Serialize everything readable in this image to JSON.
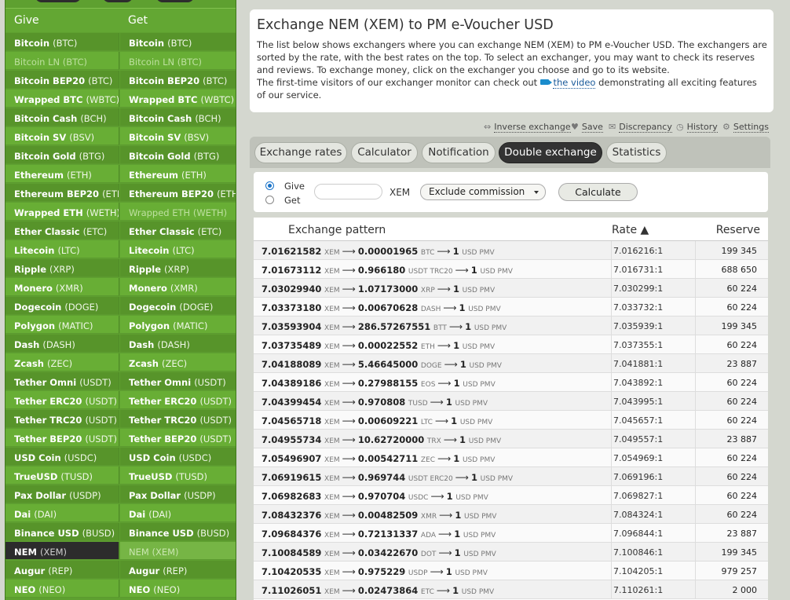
{
  "sidebar": {
    "give_label": "Give",
    "get_label": "Get",
    "rows": [
      {
        "name": "Bitcoin",
        "ticker": "(BTC)"
      },
      {
        "name": "Bitcoin LN",
        "ticker": "(BTC)"
      },
      {
        "name": "Bitcoin BEP20",
        "ticker": "(BTC)"
      },
      {
        "name": "Wrapped BTC",
        "ticker": "(WBTC)"
      },
      {
        "name": "Bitcoin Cash",
        "ticker": "(BCH)"
      },
      {
        "name": "Bitcoin SV",
        "ticker": "(BSV)"
      },
      {
        "name": "Bitcoin Gold",
        "ticker": "(BTG)"
      },
      {
        "name": "Ethereum",
        "ticker": "(ETH)"
      },
      {
        "name": "Ethereum BEP20",
        "ticker": "(ETH)"
      },
      {
        "name": "Wrapped ETH",
        "ticker": "(WETH)"
      },
      {
        "name": "Ether Classic",
        "ticker": "(ETC)"
      },
      {
        "name": "Litecoin",
        "ticker": "(LTC)"
      },
      {
        "name": "Ripple",
        "ticker": "(XRP)"
      },
      {
        "name": "Monero",
        "ticker": "(XMR)"
      },
      {
        "name": "Dogecoin",
        "ticker": "(DOGE)"
      },
      {
        "name": "Polygon",
        "ticker": "(MATIC)"
      },
      {
        "name": "Dash",
        "ticker": "(DASH)"
      },
      {
        "name": "Zcash",
        "ticker": "(ZEC)"
      },
      {
        "name": "Tether Omni",
        "ticker": "(USDT)"
      },
      {
        "name": "Tether ERC20",
        "ticker": "(USDT)"
      },
      {
        "name": "Tether TRC20",
        "ticker": "(USDT)"
      },
      {
        "name": "Tether BEP20",
        "ticker": "(USDT)"
      },
      {
        "name": "USD Coin",
        "ticker": "(USDC)"
      },
      {
        "name": "TrueUSD",
        "ticker": "(TUSD)"
      },
      {
        "name": "Pax Dollar",
        "ticker": "(USDP)"
      },
      {
        "name": "Dai",
        "ticker": "(DAI)"
      },
      {
        "name": "Binance USD",
        "ticker": "(BUSD)"
      },
      {
        "name": "NEM",
        "ticker": "(XEM)"
      },
      {
        "name": "Augur",
        "ticker": "(REP)"
      },
      {
        "name": "NEO",
        "ticker": "(NEO)"
      }
    ]
  },
  "header": {
    "title": "Exchange NEM (XEM) to PM e-Voucher USD",
    "desc_1": "The list below shows exchangers where you can exchange NEM (XEM) to PM e-Voucher USD. The exchangers are sorted by the rate, with the best rates on the top. To select an exchanger, you may want to check its reserves and reviews. To exchange money, click on the exchanger you choose and go to its website.",
    "desc_2_before": "The first-time visitors of our exchanger monitor can check out ",
    "desc_2_link": "the video",
    "desc_2_after": " demonstrating all exciting features of our service."
  },
  "tools": {
    "inverse": "Inverse exchange",
    "save": "Save",
    "discrepancy": "Discrepancy",
    "history": "History",
    "settings": "Settings"
  },
  "tabs": [
    "Exchange rates",
    "Calculator",
    "Notification",
    "Double exchange",
    "Statistics"
  ],
  "calculator": {
    "give_label": "Give",
    "get_label": "Get",
    "amount_value": "",
    "unit": "XEM",
    "commission": "Exclude commission",
    "button": "Calculate"
  },
  "table": {
    "col_pattern": "Exchange pattern",
    "col_rate": "Rate ▲",
    "col_reserve": "Reserve",
    "rows": [
      {
        "give": "7.01621582",
        "give_unit": "XEM",
        "mid": "0.00001965",
        "mid_unit": "BTC",
        "get": "1",
        "get_unit": "USD PMV",
        "rate": "7.016216:1",
        "reserve": "199 345"
      },
      {
        "give": "7.01673112",
        "give_unit": "XEM",
        "mid": "0.966180",
        "mid_unit": "USDT TRC20",
        "get": "1",
        "get_unit": "USD PMV",
        "rate": "7.016731:1",
        "reserve": "688 650"
      },
      {
        "give": "7.03029940",
        "give_unit": "XEM",
        "mid": "1.07173000",
        "mid_unit": "XRP",
        "get": "1",
        "get_unit": "USD PMV",
        "rate": "7.030299:1",
        "reserve": "60 224"
      },
      {
        "give": "7.03373180",
        "give_unit": "XEM",
        "mid": "0.00670628",
        "mid_unit": "DASH",
        "get": "1",
        "get_unit": "USD PMV",
        "rate": "7.033732:1",
        "reserve": "60 224"
      },
      {
        "give": "7.03593904",
        "give_unit": "XEM",
        "mid": "286.57267551",
        "mid_unit": "BTT",
        "get": "1",
        "get_unit": "USD PMV",
        "rate": "7.035939:1",
        "reserve": "199 345"
      },
      {
        "give": "7.03735489",
        "give_unit": "XEM",
        "mid": "0.00022552",
        "mid_unit": "ETH",
        "get": "1",
        "get_unit": "USD PMV",
        "rate": "7.037355:1",
        "reserve": "60 224"
      },
      {
        "give": "7.04188089",
        "give_unit": "XEM",
        "mid": "5.46645000",
        "mid_unit": "DOGE",
        "get": "1",
        "get_unit": "USD PMV",
        "rate": "7.041881:1",
        "reserve": "23 887"
      },
      {
        "give": "7.04389186",
        "give_unit": "XEM",
        "mid": "0.27988155",
        "mid_unit": "EOS",
        "get": "1",
        "get_unit": "USD PMV",
        "rate": "7.043892:1",
        "reserve": "60 224"
      },
      {
        "give": "7.04399454",
        "give_unit": "XEM",
        "mid": "0.970808",
        "mid_unit": "TUSD",
        "get": "1",
        "get_unit": "USD PMV",
        "rate": "7.043995:1",
        "reserve": "60 224"
      },
      {
        "give": "7.04565718",
        "give_unit": "XEM",
        "mid": "0.00609221",
        "mid_unit": "LTC",
        "get": "1",
        "get_unit": "USD PMV",
        "rate": "7.045657:1",
        "reserve": "60 224"
      },
      {
        "give": "7.04955734",
        "give_unit": "XEM",
        "mid": "10.62720000",
        "mid_unit": "TRX",
        "get": "1",
        "get_unit": "USD PMV",
        "rate": "7.049557:1",
        "reserve": "23 887"
      },
      {
        "give": "7.05496907",
        "give_unit": "XEM",
        "mid": "0.00542711",
        "mid_unit": "ZEC",
        "get": "1",
        "get_unit": "USD PMV",
        "rate": "7.054969:1",
        "reserve": "60 224"
      },
      {
        "give": "7.06919615",
        "give_unit": "XEM",
        "mid": "0.969744",
        "mid_unit": "USDT ERC20",
        "get": "1",
        "get_unit": "USD PMV",
        "rate": "7.069196:1",
        "reserve": "60 224"
      },
      {
        "give": "7.06982683",
        "give_unit": "XEM",
        "mid": "0.970704",
        "mid_unit": "USDC",
        "get": "1",
        "get_unit": "USD PMV",
        "rate": "7.069827:1",
        "reserve": "60 224"
      },
      {
        "give": "7.08432376",
        "give_unit": "XEM",
        "mid": "0.00482509",
        "mid_unit": "XMR",
        "get": "1",
        "get_unit": "USD PMV",
        "rate": "7.084324:1",
        "reserve": "60 224"
      },
      {
        "give": "7.09684376",
        "give_unit": "XEM",
        "mid": "0.72131337",
        "mid_unit": "ADA",
        "get": "1",
        "get_unit": "USD PMV",
        "rate": "7.096844:1",
        "reserve": "23 887"
      },
      {
        "give": "7.10084589",
        "give_unit": "XEM",
        "mid": "0.03422670",
        "mid_unit": "DOT",
        "get": "1",
        "get_unit": "USD PMV",
        "rate": "7.100846:1",
        "reserve": "199 345"
      },
      {
        "give": "7.10420535",
        "give_unit": "XEM",
        "mid": "0.975229",
        "mid_unit": "USDP",
        "get": "1",
        "get_unit": "USD PMV",
        "rate": "7.104205:1",
        "reserve": "979 257"
      },
      {
        "give": "7.11026051",
        "give_unit": "XEM",
        "mid": "0.02473864",
        "mid_unit": "ETC",
        "get": "1",
        "get_unit": "USD PMV",
        "rate": "7.110261:1",
        "reserve": "2 000"
      }
    ]
  }
}
